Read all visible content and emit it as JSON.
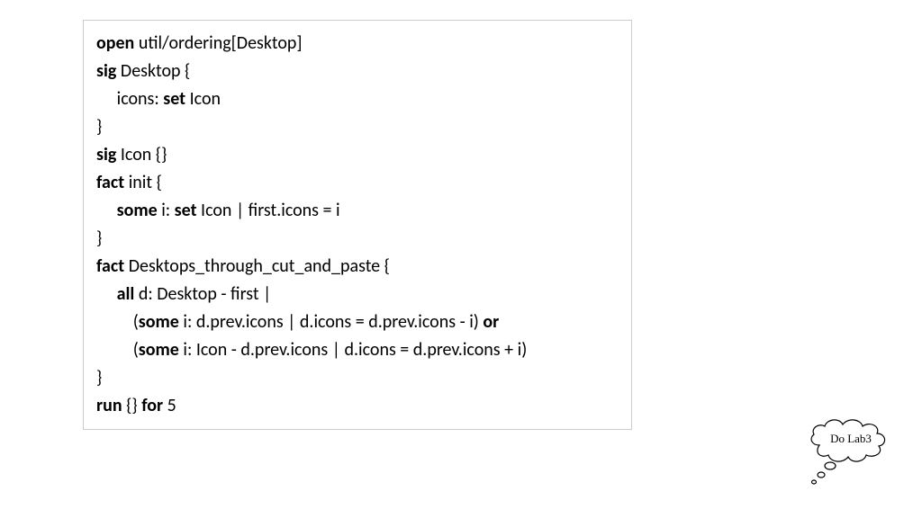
{
  "code": {
    "l1_kw": "open",
    "l1_rest": " util/ordering[Desktop]",
    "l2_kw": "sig",
    "l2_rest": " Desktop {",
    "l3_pre": "     icons: ",
    "l3_kw": "set",
    "l3_rest": " Icon",
    "l4": "}",
    "l5_kw": "sig",
    "l5_rest": " Icon {}",
    "l6_kw": "fact",
    "l6_rest": " init {",
    "l7_pre": "     ",
    "l7_kw1": "some",
    "l7_mid": " i: ",
    "l7_kw2": "set",
    "l7_rest": " Icon | first.icons = i",
    "l8": "}",
    "l9_kw": "fact",
    "l9_rest": " Desktops_through_cut_and_paste {",
    "l10_pre": "     ",
    "l10_kw": "all",
    "l10_rest": " d: Desktop - first |",
    "l11_pre": "         (",
    "l11_kw1": "some",
    "l11_mid": " i: d.prev.icons | d.icons = d.prev.icons - i) ",
    "l11_kw2": "or",
    "l12_pre": "         (",
    "l12_kw": "some",
    "l12_rest": " i: Icon - d.prev.icons | d.icons = d.prev.icons + i)",
    "l13": "}",
    "l14_kw1": "run",
    "l14_mid": " {} ",
    "l14_kw2": "for",
    "l14_rest": " 5"
  },
  "thought": {
    "label": "Do Lab3"
  }
}
